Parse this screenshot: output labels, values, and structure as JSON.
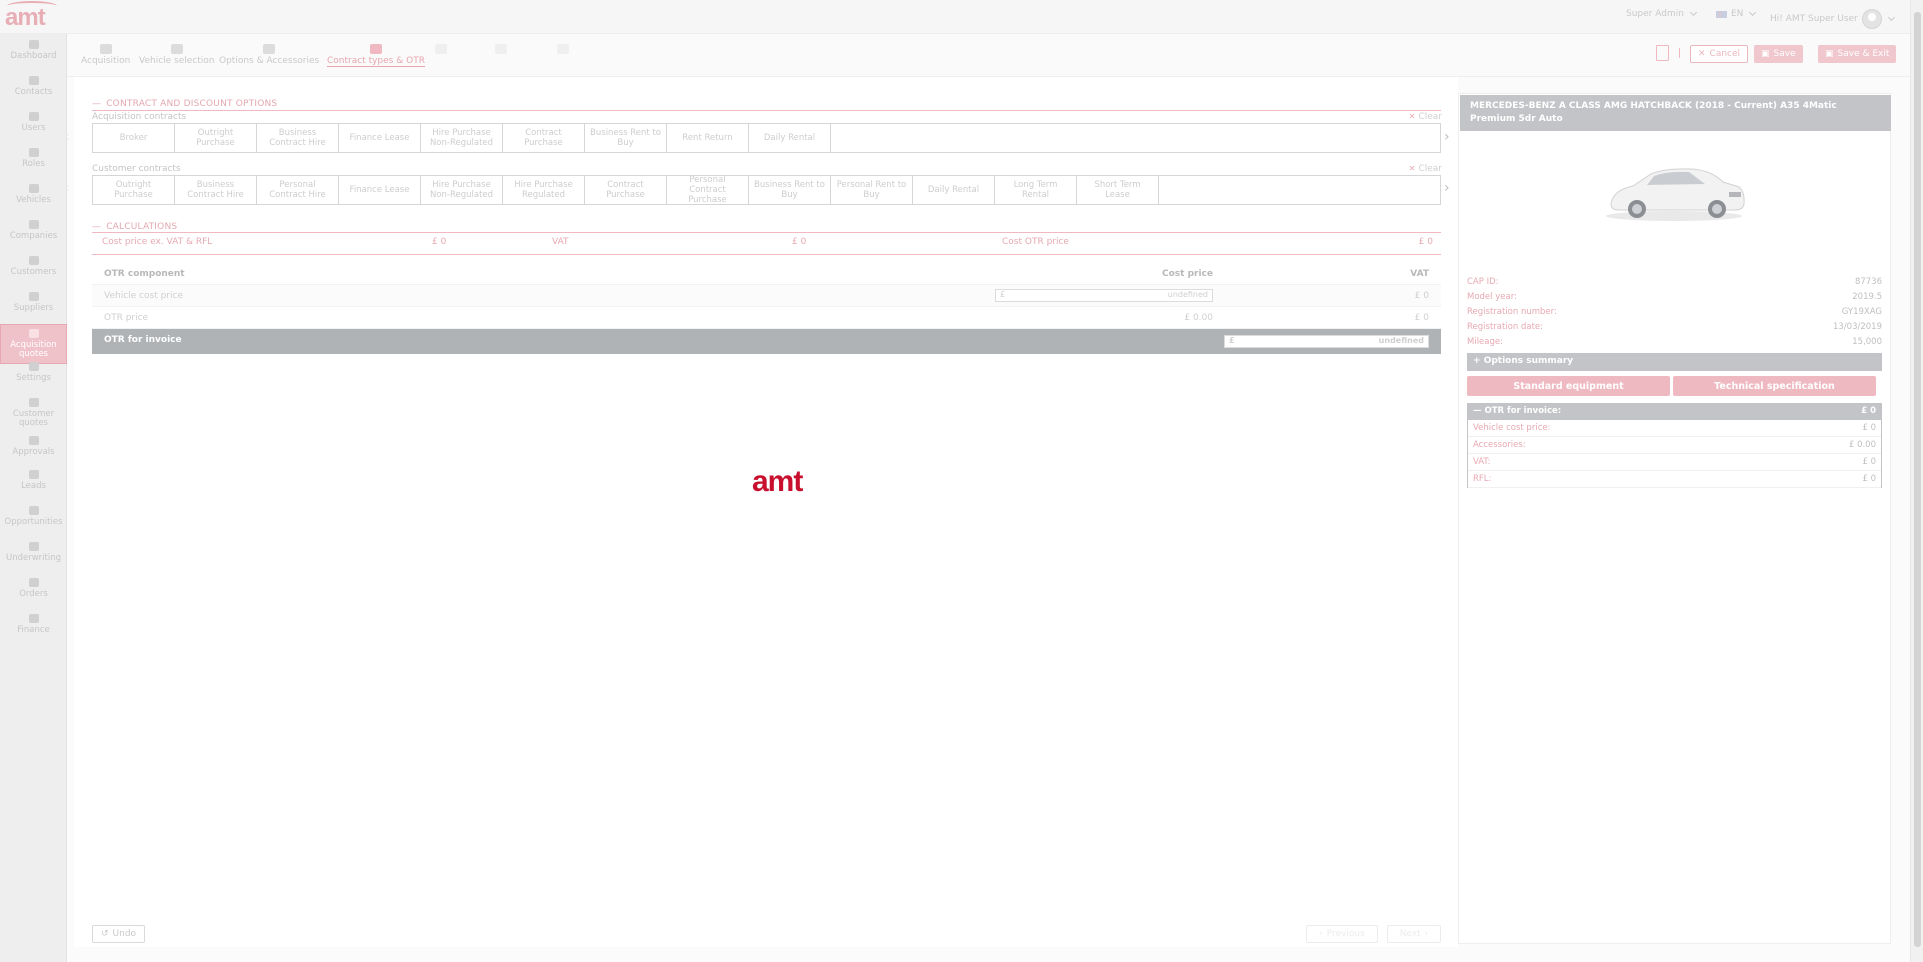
{
  "app": {
    "logo": "amt"
  },
  "topbar": {
    "role": "Super Admin",
    "language": "EN",
    "greeting": "Hi! AMT Super User"
  },
  "sidebar": {
    "items": [
      {
        "label": "Dashboard",
        "icon": "home-icon"
      },
      {
        "label": "Contacts",
        "icon": "contacts-icon"
      },
      {
        "label": "Users",
        "icon": "user-icon"
      },
      {
        "label": "Roles",
        "icon": "roles-icon"
      },
      {
        "label": "Vehicles",
        "icon": "car-icon"
      },
      {
        "label": "Companies",
        "icon": "companies-icon"
      },
      {
        "label": "Customers",
        "icon": "customers-icon"
      },
      {
        "label": "Suppliers",
        "icon": "truck-icon"
      },
      {
        "label": "Acquisition quotes",
        "icon": "acquisition-icon",
        "active": true
      },
      {
        "label": "Settings",
        "icon": "gear-icon"
      },
      {
        "label": "Customer quotes",
        "icon": "customer-quotes-icon"
      },
      {
        "label": "Approvals",
        "icon": "check-icon"
      },
      {
        "label": "Leads",
        "icon": "leads-icon"
      },
      {
        "label": "Opportunities",
        "icon": "lightbulb-icon"
      },
      {
        "label": "Underwriting",
        "icon": "underwriting-icon"
      },
      {
        "label": "Orders",
        "icon": "cart-icon"
      },
      {
        "label": "Finance",
        "icon": "pound-icon"
      }
    ]
  },
  "steps": [
    {
      "label": "Acquisition",
      "state": "done"
    },
    {
      "label": "Vehicle selection",
      "state": "done"
    },
    {
      "label": "Options & Accessories",
      "state": "done"
    },
    {
      "label": "Contract types & OTR",
      "state": "active"
    },
    {
      "label": "",
      "state": "disabled"
    },
    {
      "label": "",
      "state": "disabled"
    },
    {
      "label": "",
      "state": "disabled"
    }
  ],
  "header_buttons": {
    "cancel": "Cancel",
    "save": "Save",
    "save_exit": "Save & Exit"
  },
  "contract_section": {
    "title": "CONTRACT AND DISCOUNT OPTIONS",
    "acquisition_label": "Acquisition contracts",
    "customer_label": "Customer contracts",
    "clear": "Clear",
    "acquisition_contracts": [
      "Broker",
      "Outright Purchase",
      "Business Contract Hire",
      "Finance Lease",
      "Hire Purchase Non-Regulated",
      "Contract Purchase",
      "Business Rent to Buy",
      "Rent Return",
      "Daily Rental"
    ],
    "customer_contracts": [
      "Outright Purchase",
      "Business Contract Hire",
      "Personal Contract Hire",
      "Finance Lease",
      "Hire Purchase Non-Regulated",
      "Hire Purchase Regulated",
      "Contract Purchase",
      "Personal Contract Purchase",
      "Business Rent to Buy",
      "Personal Rent to Buy",
      "Daily Rental",
      "Long Term Rental",
      "Short Term Lease"
    ]
  },
  "calculations": {
    "title": "CALCULATIONS",
    "cost_price_label": "Cost price ex. VAT & RFL",
    "cost_price_value": "£ 0",
    "vat_label": "VAT",
    "vat_value": "£ 0",
    "cost_otr_label": "Cost OTR price",
    "cost_otr_value": "£ 0"
  },
  "otr_table": {
    "headers": {
      "component": "OTR component",
      "cost": "Cost price",
      "vat": "VAT"
    },
    "rows": [
      {
        "component": "Vehicle cost price",
        "input_prefix": "£",
        "input_value": "undefined",
        "vat": "£ 0"
      },
      {
        "component": "OTR price",
        "cost": "£ 0.00",
        "vat": "£ 0"
      }
    ],
    "invoice": {
      "label": "OTR for invoice",
      "input_prefix": "£",
      "input_value": "undefined"
    }
  },
  "loader_logo": "amt",
  "footer": {
    "undo": "Undo",
    "previous": "Previous",
    "next": "Next"
  },
  "vehicle": {
    "title": "MERCEDES-BENZ A CLASS AMG HATCHBACK (2018 - Current) A35 4Matic Premium 5dr Auto",
    "specs": [
      {
        "label": "CAP ID:",
        "value": "87736"
      },
      {
        "label": "Model year:",
        "value": "2019.5"
      },
      {
        "label": "Registration number:",
        "value": "GY19XAG"
      },
      {
        "label": "Registration date:",
        "value": "13/03/2019"
      },
      {
        "label": "Mileage:",
        "value": "15,000"
      }
    ],
    "options_summary": "Options summary",
    "standard_equipment": "Standard equipment",
    "technical_specification": "Technical specification",
    "otr_summary": {
      "title": "OTR for invoice:",
      "title_value": "£ 0",
      "rows": [
        {
          "label": "Vehicle cost price:",
          "value": "£ 0"
        },
        {
          "label": "Accessories:",
          "value": "£ 0.00"
        },
        {
          "label": "VAT:",
          "value": "£ 0"
        },
        {
          "label": "RFL:",
          "value": "£ 0"
        }
      ]
    }
  }
}
